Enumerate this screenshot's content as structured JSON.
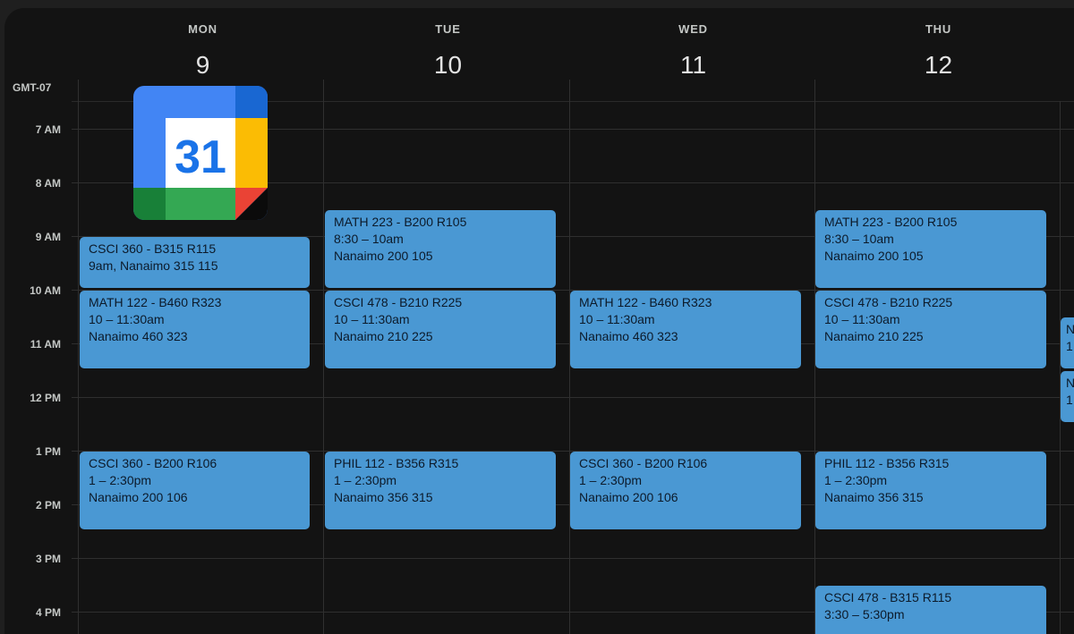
{
  "timezone": "GMT-07",
  "days": [
    {
      "dow": "MON",
      "num": "9"
    },
    {
      "dow": "TUE",
      "num": "10"
    },
    {
      "dow": "WED",
      "num": "11"
    },
    {
      "dow": "THU",
      "num": "12"
    }
  ],
  "hours": [
    "7 AM",
    "8 AM",
    "9 AM",
    "10 AM",
    "11 AM",
    "12 PM",
    "1 PM",
    "2 PM",
    "3 PM",
    "4 PM"
  ],
  "logo": {
    "text": "31",
    "colors": {
      "blue": "#4285f4",
      "dark_blue": "#1967d2",
      "yellow": "#fbbc04",
      "green": "#34a853",
      "dark_green": "#188038",
      "red": "#ea4335"
    }
  },
  "event_color": "#4a98d3",
  "events": [
    {
      "title": "CSCI 360 - B315 R115",
      "line2": "9am, Nanaimo 315 115",
      "line3": ""
    },
    {
      "title": "MATH 122 - B460 R323",
      "line2": "10 – 11:30am",
      "line3": "Nanaimo 460 323"
    },
    {
      "title": "CSCI 360 - B200 R106",
      "line2": "1 – 2:30pm",
      "line3": "Nanaimo 200 106"
    },
    {
      "title": "MATH 223 - B200 R105",
      "line2": "8:30 – 10am",
      "line3": "Nanaimo 200 105"
    },
    {
      "title": "CSCI 478 - B210 R225",
      "line2": "10 – 11:30am",
      "line3": "Nanaimo 210 225"
    },
    {
      "title": "PHIL 112 - B356 R315",
      "line2": "1 – 2:30pm",
      "line3": "Nanaimo 356 315"
    },
    {
      "title": "MATH 122 - B460 R323",
      "line2": "10 – 11:30am",
      "line3": "Nanaimo 460 323"
    },
    {
      "title": "CSCI 360 - B200 R106",
      "line2": "1 – 2:30pm",
      "line3": "Nanaimo 200 106"
    },
    {
      "title": "MATH 223 - B200 R105",
      "line2": "8:30 – 10am",
      "line3": "Nanaimo 200 105"
    },
    {
      "title": "CSCI 478 - B210 R225",
      "line2": "10 – 11:30am",
      "line3": "Nanaimo 210 225"
    },
    {
      "title": "PHIL 112 - B356 R315",
      "line2": "1 – 2:30pm",
      "line3": "Nanaimo 356 315"
    },
    {
      "title": "CSCI 478 - B315 R115",
      "line2": "3:30 – 5:30pm",
      "line3": ""
    },
    {
      "title": "N",
      "line2": "1",
      "line3": ""
    },
    {
      "title": "N",
      "line2": "1",
      "line3": ""
    }
  ]
}
